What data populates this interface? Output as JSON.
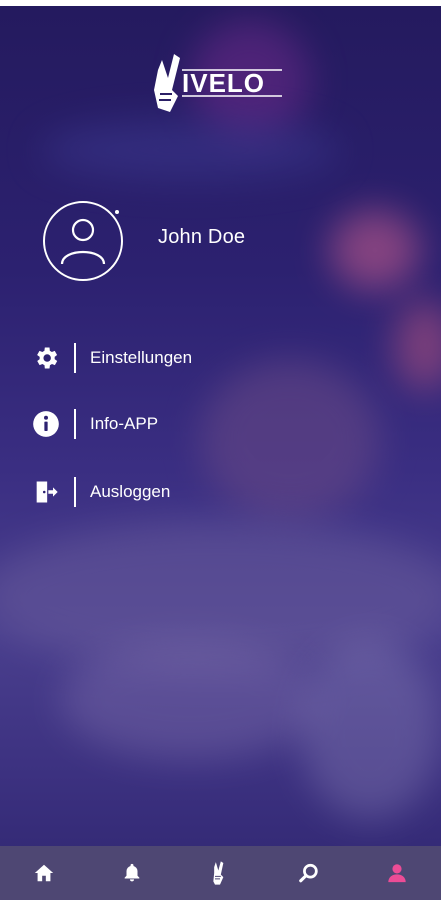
{
  "app": {
    "brand": "VIVELO"
  },
  "profile": {
    "name": "John Doe"
  },
  "menu": [
    {
      "id": "settings",
      "label": "Einstellungen",
      "icon": "gear-icon"
    },
    {
      "id": "info",
      "label": "Info-APP",
      "icon": "info-icon"
    },
    {
      "id": "logout",
      "label": "Ausloggen",
      "icon": "logout-icon"
    }
  ],
  "bottom_nav": [
    {
      "id": "home",
      "icon": "home-icon",
      "active": false
    },
    {
      "id": "notifications",
      "icon": "bell-icon",
      "active": false
    },
    {
      "id": "vivelo",
      "icon": "vivelo-hand-icon",
      "active": false
    },
    {
      "id": "search",
      "icon": "search-icon",
      "active": false
    },
    {
      "id": "profile",
      "icon": "user-icon",
      "active": true
    }
  ],
  "colors": {
    "accent": "#ec4c96",
    "nav_bg": "#4e4773",
    "text": "#ffffff"
  }
}
